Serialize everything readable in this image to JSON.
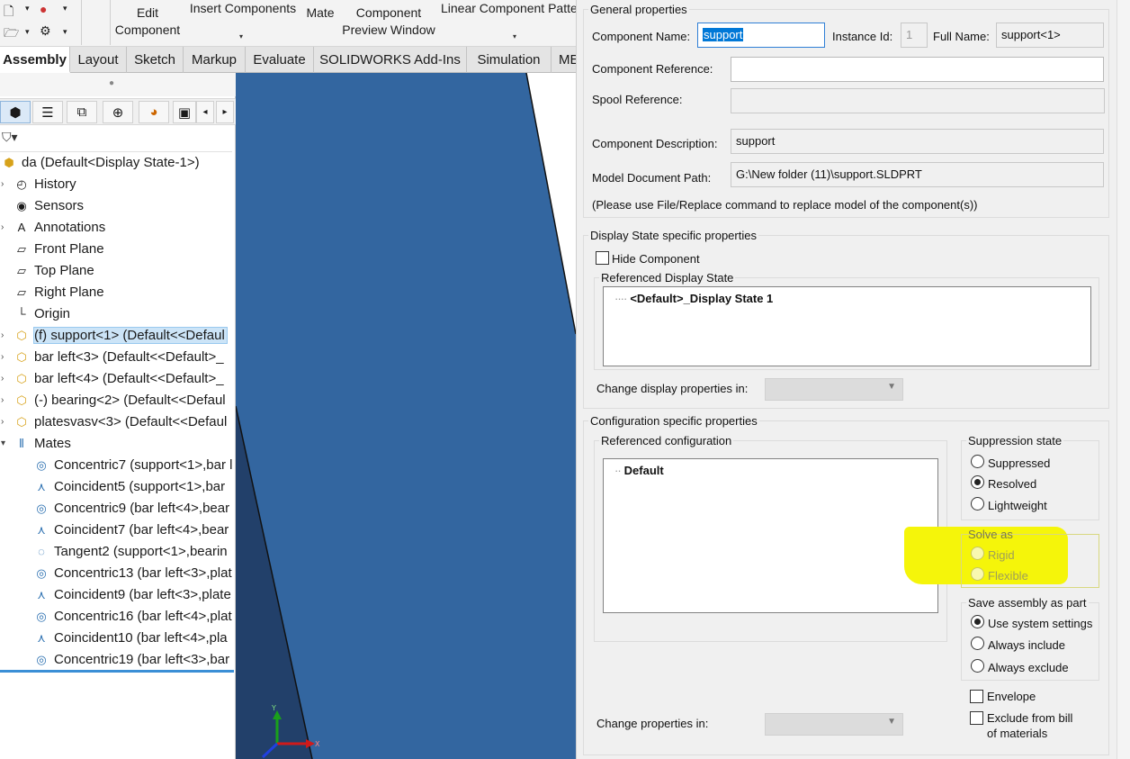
{
  "ribbon": {
    "edit_component": [
      "Edit",
      "Component"
    ],
    "insert_components": "Insert Components",
    "mate": "Mate",
    "component_preview": [
      "Component",
      "Preview Window"
    ],
    "linear_pattern": "Linear Component Patte"
  },
  "tabs": [
    {
      "label": "Assembly",
      "active": true
    },
    {
      "label": "Layout"
    },
    {
      "label": "Sketch"
    },
    {
      "label": "Markup"
    },
    {
      "label": "Evaluate"
    },
    {
      "label": "SOLIDWORKS Add-Ins"
    },
    {
      "label": "Simulation"
    },
    {
      "label": "ME"
    }
  ],
  "tree": [
    {
      "icon": "assembly-icon",
      "glyph": "⬢",
      "label": "da  (Default<Display State-1>)",
      "expand": false,
      "indent": 0
    },
    {
      "icon": "history-icon",
      "glyph": "◴",
      "label": "History",
      "expand": true,
      "indent": 1
    },
    {
      "icon": "sensor-icon",
      "glyph": "◉",
      "label": "Sensors",
      "expand": false,
      "indent": 1
    },
    {
      "icon": "annotations-icon",
      "glyph": "A",
      "label": "Annotations",
      "expand": true,
      "indent": 1
    },
    {
      "icon": "plane-icon",
      "glyph": "▱",
      "label": "Front Plane",
      "expand": false,
      "indent": 1
    },
    {
      "icon": "plane-icon",
      "glyph": "▱",
      "label": "Top Plane",
      "expand": false,
      "indent": 1
    },
    {
      "icon": "plane-icon",
      "glyph": "▱",
      "label": "Right Plane",
      "expand": false,
      "indent": 1
    },
    {
      "icon": "origin-icon",
      "glyph": "└",
      "label": "Origin",
      "expand": false,
      "indent": 1
    },
    {
      "icon": "part-icon",
      "glyph": "⬡",
      "label": "(f) support<1> (Default<<Defaul",
      "expand": true,
      "indent": 1,
      "selected": true
    },
    {
      "icon": "part-icon",
      "glyph": "⬡",
      "label": "bar left<3> (Default<<Default>_",
      "expand": true,
      "indent": 1
    },
    {
      "icon": "part-icon",
      "glyph": "⬡",
      "label": "bar left<4> (Default<<Default>_",
      "expand": true,
      "indent": 1
    },
    {
      "icon": "part-icon",
      "glyph": "⬡",
      "label": "(-) bearing<2> (Default<<Defaul",
      "expand": true,
      "indent": 1
    },
    {
      "icon": "part-icon",
      "glyph": "⬡",
      "label": "platesvasv<3> (Default<<Defaul",
      "expand": true,
      "indent": 1
    },
    {
      "icon": "mates-icon",
      "glyph": "⫴",
      "label": "Mates",
      "expand": true,
      "expanded": true,
      "indent": 1
    },
    {
      "icon": "concentric-mate-icon",
      "glyph": "◎",
      "label": "Concentric7 (support<1>,bar l",
      "indent": 2
    },
    {
      "icon": "coincident-mate-icon",
      "glyph": "⋏",
      "label": "Coincident5 (support<1>,bar",
      "indent": 2
    },
    {
      "icon": "concentric-mate-icon",
      "glyph": "◎",
      "label": "Concentric9 (bar left<4>,bear",
      "indent": 2
    },
    {
      "icon": "coincident-mate-icon",
      "glyph": "⋏",
      "label": "Coincident7 (bar left<4>,bear",
      "indent": 2
    },
    {
      "icon": "tangent-mate-icon",
      "glyph": "◌",
      "label": "Tangent2 (support<1>,bearin",
      "indent": 2
    },
    {
      "icon": "concentric-mate-icon",
      "glyph": "◎",
      "label": "Concentric13 (bar left<3>,plat",
      "indent": 2
    },
    {
      "icon": "coincident-mate-icon",
      "glyph": "⋏",
      "label": "Coincident9 (bar left<3>,plate",
      "indent": 2
    },
    {
      "icon": "concentric-mate-icon",
      "glyph": "◎",
      "label": "Concentric16 (bar left<4>,plat",
      "indent": 2
    },
    {
      "icon": "coincident-mate-icon",
      "glyph": "⋏",
      "label": "Coincident10 (bar left<4>,pla",
      "indent": 2
    },
    {
      "icon": "concentric-mate-icon",
      "glyph": "◎",
      "label": "Concentric19 (bar left<3>,bar",
      "indent": 2
    }
  ],
  "triad": {
    "y": "Y",
    "x": "X"
  },
  "dialog": {
    "general": {
      "title": "General properties",
      "component_name_label": "Component Name:",
      "component_name_value": "support",
      "instance_id_label": "Instance Id:",
      "instance_id_value": "1",
      "full_name_label": "Full Name:",
      "full_name_value": "support<1>",
      "component_reference_label": "Component Reference:",
      "component_reference_value": "",
      "spool_reference_label": "Spool Reference:",
      "spool_reference_value": "",
      "component_description_label": "Component Description:",
      "component_description_value": "support",
      "model_path_label": "Model Document Path:",
      "model_path_value": "G:\\New folder (11)\\support.SLDPRT",
      "replace_note": "(Please use File/Replace command to replace model of the component(s))"
    },
    "display_state": {
      "title": "Display State specific properties",
      "hide_component": "Hide Component",
      "referenced_display_state": "Referenced Display State",
      "display_state_item": "<Default>_Display State 1",
      "change_display_props_in": "Change display properties in:"
    },
    "configuration": {
      "title": "Configuration specific properties",
      "referenced_configuration": "Referenced configuration",
      "config_item": "Default",
      "suppression_title": "Suppression state",
      "suppression_options": [
        {
          "label": "Suppressed",
          "checked": false
        },
        {
          "label": "Resolved",
          "checked": true
        },
        {
          "label": "Lightweight",
          "checked": false
        }
      ],
      "solve_as_title": "Solve as",
      "solve_as_options": [
        {
          "label": "Rigid",
          "disabled": true
        },
        {
          "label": "Flexible",
          "disabled": true
        }
      ],
      "save_assembly_title": "Save assembly as part",
      "save_assembly_options": [
        {
          "label": "Use system settings",
          "checked": true
        },
        {
          "label": "Always include",
          "checked": false
        },
        {
          "label": "Always exclude",
          "checked": false
        }
      ],
      "envelope": "Envelope",
      "exclude_bom": [
        "Exclude from bill",
        "of materials"
      ],
      "change_props_in": "Change properties in:"
    }
  },
  "colors": {
    "graphics_bg": "#3366a0",
    "selection": "#0078d7",
    "highlight": "#f5f50a",
    "tree_selected": "#cce4f7"
  }
}
